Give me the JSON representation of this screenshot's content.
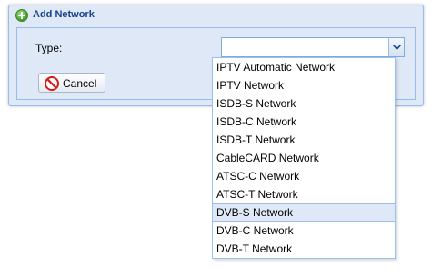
{
  "dialog": {
    "title": "Add Network",
    "type_label": "Type:",
    "type_value": "",
    "cancel_label": "Cancel"
  },
  "dropdown": {
    "selected_index": 8,
    "items": [
      "IPTV Automatic Network",
      "IPTV Network",
      "ISDB-S Network",
      "ISDB-C Network",
      "ISDB-T Network",
      "CableCARD Network",
      "ATSC-C Network",
      "ATSC-T Network",
      "DVB-S Network",
      "DVB-C Network",
      "DVB-T Network"
    ]
  },
  "icons": {
    "title": "add-circle-icon",
    "cancel": "no-entry-icon",
    "trigger": "chevron-down-icon"
  },
  "colors": {
    "title_text": "#15428b",
    "panel_bg": "#dfe8f6",
    "panel_border": "#99bbe8",
    "selected_item_bg": "#dfe8f6"
  }
}
